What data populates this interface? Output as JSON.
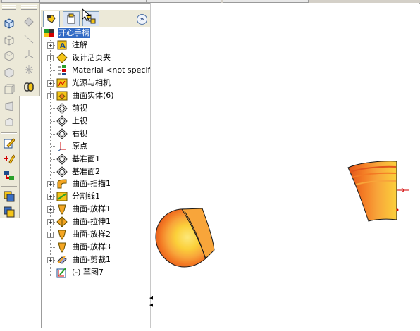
{
  "toolbar_left": {
    "icons": [
      "view-cube-icon",
      "view-wireframe-icon",
      "view-hidden-lines-icon",
      "view-shaded-icon",
      "view-edges-icon",
      "view-perspective-icon",
      "view-section-icon",
      "sketch-icon",
      "smart-dimension-icon",
      "relations-icon",
      "display-mode-icon",
      "display-mode-2-icon"
    ]
  },
  "toolbar_second": {
    "icons": [
      "point-icon",
      "line-icon",
      "axis-icon",
      "spark-icon",
      "paperclip-icon"
    ]
  },
  "panel": {
    "tabs": [
      "feature-manager-tab",
      "property-manager-tab",
      "configuration-manager-tab"
    ],
    "expand_label": "»"
  },
  "tree": {
    "root": "开心手柄",
    "items": [
      {
        "label": "注解",
        "expand": true,
        "icon": "annotation-icon"
      },
      {
        "label": "设计活页夹",
        "expand": true,
        "icon": "design-binder-icon"
      },
      {
        "label": "Material <not specified",
        "expand": false,
        "icon": "material-icon"
      },
      {
        "label": "光源与相机",
        "expand": true,
        "icon": "lights-camera-icon"
      },
      {
        "label": "曲面实体(6)",
        "expand": true,
        "icon": "surface-bodies-icon"
      },
      {
        "label": "前视",
        "expand": false,
        "icon": "plane-icon"
      },
      {
        "label": "上视",
        "expand": false,
        "icon": "plane-icon"
      },
      {
        "label": "右视",
        "expand": false,
        "icon": "plane-icon"
      },
      {
        "label": "原点",
        "expand": false,
        "icon": "origin-icon"
      },
      {
        "label": "基准面1",
        "expand": false,
        "icon": "plane-icon"
      },
      {
        "label": "基准面2",
        "expand": false,
        "icon": "plane-icon"
      },
      {
        "label": "曲面-扫描1",
        "expand": true,
        "icon": "surface-sweep-icon"
      },
      {
        "label": "分割线1",
        "expand": true,
        "icon": "split-line-icon"
      },
      {
        "label": "曲面-放样1",
        "expand": true,
        "icon": "surface-loft-icon"
      },
      {
        "label": "曲面-拉伸1",
        "expand": true,
        "icon": "surface-extrude-icon"
      },
      {
        "label": "曲面-放样2",
        "expand": true,
        "icon": "surface-loft-icon"
      },
      {
        "label": "曲面-放样3",
        "expand": false,
        "icon": "surface-loft-icon"
      },
      {
        "label": "曲面-剪裁1",
        "expand": true,
        "icon": "surface-trim-icon"
      },
      {
        "label": "(-) 草图7",
        "expand": false,
        "icon": "sketch-icon"
      }
    ]
  },
  "colors": {
    "toolbar_bg": "#ece9d8",
    "selection": "#316ac5",
    "surface_outer": "#e8501a",
    "surface_mid": "#f58a1f",
    "surface_inner": "#fbd03a"
  }
}
